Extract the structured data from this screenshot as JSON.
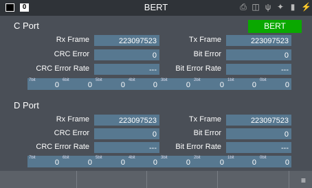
{
  "header": {
    "title": "BERT"
  },
  "bert_button": "BERT",
  "c_port": {
    "title": "C Port",
    "rx_frame_label": "Rx Frame",
    "rx_frame": "223097523",
    "tx_frame_label": "Tx Frame",
    "tx_frame": "223097523",
    "crc_error_label": "CRC Error",
    "crc_error": "0",
    "bit_error_label": "Bit Error",
    "bit_error": "0",
    "crc_rate_label": "CRC Error Rate",
    "crc_rate": "---",
    "bit_rate_label": "Bit Error Rate",
    "bit_rate": "---",
    "bits": [
      {
        "label": "7bit",
        "value": "0"
      },
      {
        "label": "6bit",
        "value": "0"
      },
      {
        "label": "5bit",
        "value": "0"
      },
      {
        "label": "4bit",
        "value": "0"
      },
      {
        "label": "3bit",
        "value": "0"
      },
      {
        "label": "2bit",
        "value": "0"
      },
      {
        "label": "1bit",
        "value": "0"
      },
      {
        "label": "0bit",
        "value": "0"
      }
    ]
  },
  "d_port": {
    "title": "D Port",
    "rx_frame_label": "Rx Frame",
    "rx_frame": "223097523",
    "tx_frame_label": "Tx Frame",
    "tx_frame": "223097523",
    "crc_error_label": "CRC Error",
    "crc_error": "0",
    "bit_error_label": "Bit Error",
    "bit_error": "0",
    "crc_rate_label": "CRC Error Rate",
    "crc_rate": "---",
    "bit_rate_label": "Bit Error Rate",
    "bit_rate": "---",
    "bits": [
      {
        "label": "7bit",
        "value": "0"
      },
      {
        "label": "6bit",
        "value": "0"
      },
      {
        "label": "5bit",
        "value": "0"
      },
      {
        "label": "4bit",
        "value": "0"
      },
      {
        "label": "3bit",
        "value": "0"
      },
      {
        "label": "2bit",
        "value": "0"
      },
      {
        "label": "1bit",
        "value": "0"
      },
      {
        "label": "0bit",
        "value": "0"
      }
    ]
  },
  "colors": {
    "bert_active": "#0aa800",
    "field_bg": "#577890",
    "background": "#4a4f57"
  },
  "icons": [
    "stop-icon",
    "info-icon",
    "printer-icon",
    "network-icon",
    "usb-icon",
    "wrench-icon",
    "battery-icon",
    "plug-icon",
    "menu-icon"
  ]
}
